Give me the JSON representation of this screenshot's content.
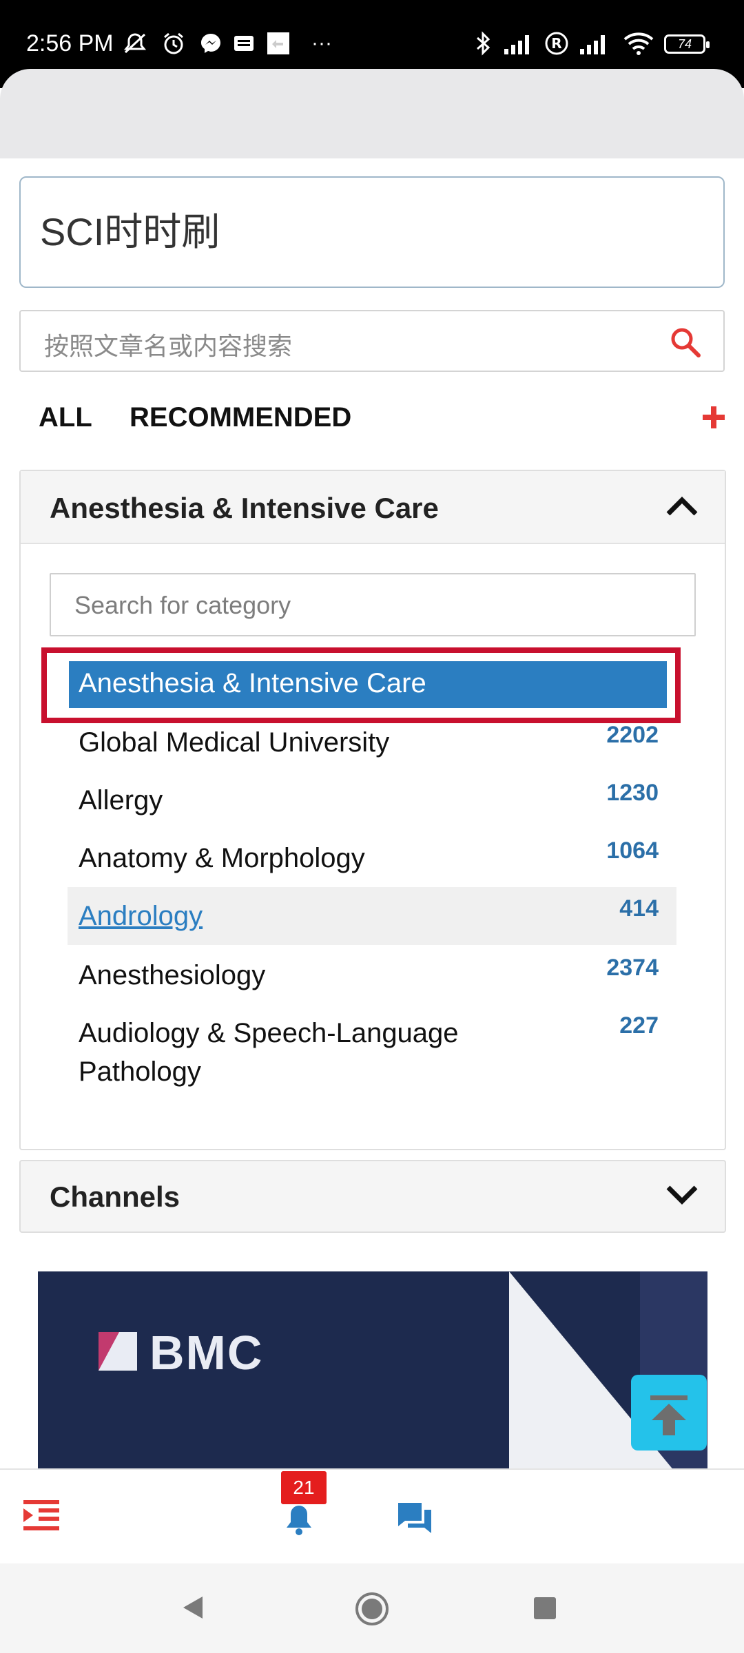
{
  "status_bar": {
    "time": "2:56 PM",
    "battery": "74",
    "more": "···"
  },
  "title_box": {
    "text": "SCI时时刷"
  },
  "article_search": {
    "placeholder": "按照文章名或内容搜索"
  },
  "tabs": [
    {
      "label": "ALL"
    },
    {
      "label": "RECOMMENDED"
    }
  ],
  "category_panel": {
    "header": "Anesthesia & Intensive Care",
    "search_placeholder": "Search for category",
    "selected": "Anesthesia & Intensive Care",
    "items": [
      {
        "name": "Global Medical University",
        "count": "2202"
      },
      {
        "name": "Allergy",
        "count": "1230"
      },
      {
        "name": "Anatomy & Morphology",
        "count": "1064"
      },
      {
        "name": "Andrology",
        "count": "414"
      },
      {
        "name": "Anesthesiology",
        "count": "2374"
      },
      {
        "name": "Audiology & Speech-Language Pathology",
        "count": "227"
      }
    ]
  },
  "channels": {
    "header": "Channels"
  },
  "banner": {
    "brand": "BMC"
  },
  "bottom_bar": {
    "notification_count": "21"
  },
  "colors": {
    "accent": "#2b7ec1",
    "highlight_outline": "#c8102e",
    "count": "#2b6fa8",
    "red_icon": "#e53935",
    "back_to_top": "#24c2ea",
    "banner_bg": "#1d2a4e"
  },
  "icons": {
    "article_search": "search-icon",
    "add_tab": "plus-icon",
    "panel_toggle": "chevron-up-icon",
    "channels_toggle": "chevron-down-icon",
    "menu": "menu-indent-icon",
    "notifications": "bell-icon",
    "messages": "chat-icon",
    "back_to_top": "arrow-to-top-icon"
  }
}
